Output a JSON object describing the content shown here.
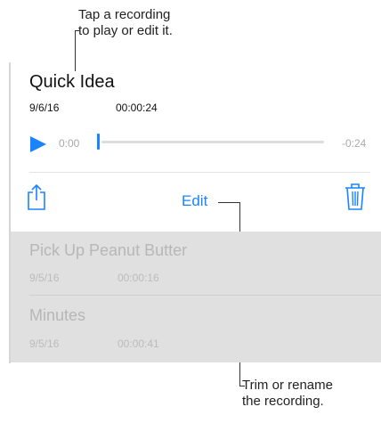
{
  "callouts": {
    "top_line1": "Tap a recording",
    "top_line2": "to play or edit it.",
    "bottom_line1": "Trim or rename",
    "bottom_line2": "the recording."
  },
  "recording": {
    "title": "Quick Idea",
    "date": "9/6/16",
    "duration": "00:00:24",
    "elapsed": "0:00",
    "remaining": "-0:24",
    "progress": 0.0
  },
  "actions": {
    "edit_label": "Edit",
    "share_icon": "share-icon",
    "trash_icon": "trash-icon"
  },
  "list": {
    "items": [
      {
        "title": "Pick Up Peanut Butter",
        "date": "9/5/16",
        "duration": "00:00:16"
      },
      {
        "title": "Minutes",
        "date": "9/5/16",
        "duration": "00:00:41"
      }
    ]
  },
  "colors": {
    "accent": "#1a84ff",
    "list_background": "#e0e0e0",
    "muted_text": "#b7b7b7"
  }
}
